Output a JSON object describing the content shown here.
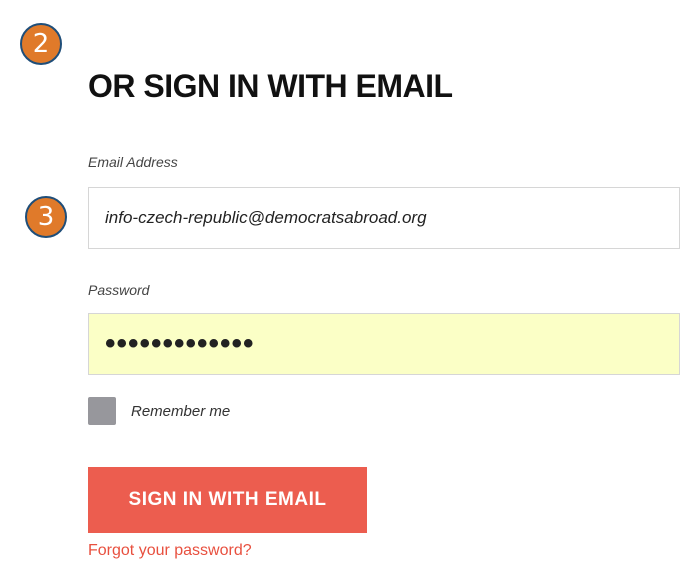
{
  "badges": {
    "step_2": "2",
    "step_3": "3"
  },
  "heading": "OR SIGN IN WITH EMAIL",
  "email": {
    "label": "Email Address",
    "value": "info-czech-republic@democratsabroad.org"
  },
  "password": {
    "label": "Password",
    "masked_value": "•••••••••••••"
  },
  "remember": {
    "label": "Remember me",
    "checked": false
  },
  "signin_button_label": "SIGN IN WITH EMAIL",
  "forgot_password_link": "Forgot your password?",
  "colors": {
    "badge_fill": "#e07a2a",
    "badge_border": "#1f4e79",
    "button": "#ec5d4f",
    "link": "#e8503f",
    "password_bg": "#fbffc6",
    "checkbox": "#97979c"
  }
}
